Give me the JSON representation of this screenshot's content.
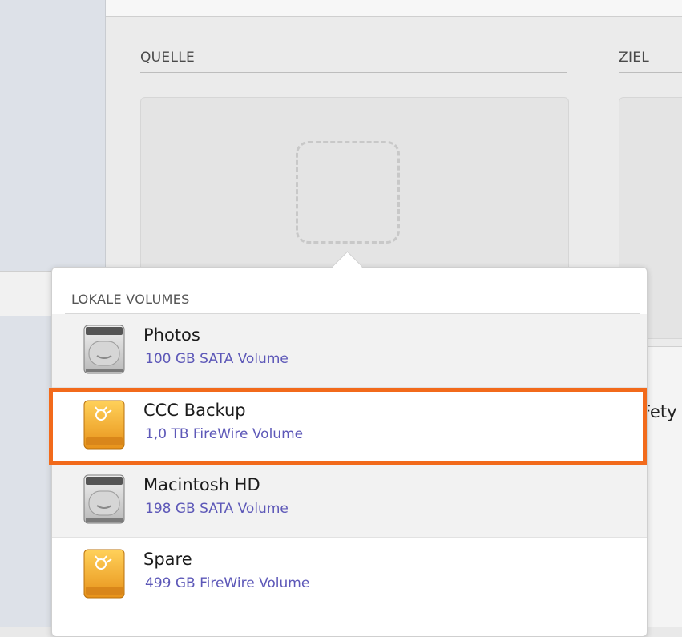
{
  "source": {
    "label": "QUELLE"
  },
  "destination": {
    "label": "ZIEL"
  },
  "partial_text": "Fety",
  "popover": {
    "header": "LOKALE VOLUMES",
    "volumes": [
      {
        "name": "Photos",
        "desc": "100 GB SATA Volume",
        "icon": "hard-disk-icon"
      },
      {
        "name": "CCC Backup",
        "desc": "1,0 TB FireWire Volume",
        "icon": "firewire-disk-icon"
      },
      {
        "name": "Macintosh HD",
        "desc": "198 GB SATA Volume",
        "icon": "hard-disk-icon"
      },
      {
        "name": "Spare",
        "desc": "499 GB FireWire Volume",
        "icon": "firewire-disk-icon"
      }
    ]
  },
  "colors": {
    "highlight": "#f26a1b",
    "volume_desc": "#5d58b8",
    "firewire_drive": "#f2a925"
  }
}
